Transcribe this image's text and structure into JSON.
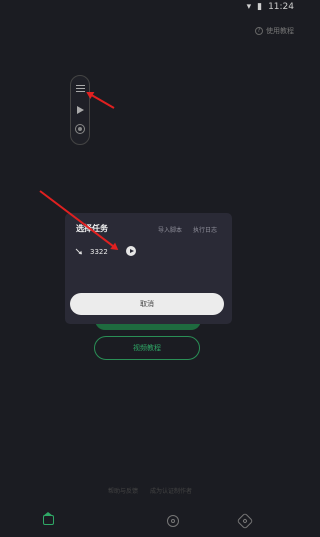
{
  "status_bar": {
    "time": "11:24"
  },
  "top": {
    "help_label": "使用教程"
  },
  "dialog": {
    "title": "选择任务",
    "tab_import": "导入脚本",
    "tab_log": "执行日志",
    "task_name": "3322",
    "cancel_label": "取消"
  },
  "background": {
    "secondary_button_label": "视频教程"
  },
  "footer": {
    "link_left": "帮助与反馈",
    "link_right": "成为认证制作者"
  },
  "colors": {
    "accent": "#2fa866",
    "dialog_bg": "#2a2a36",
    "page_bg": "#1b1c22"
  }
}
